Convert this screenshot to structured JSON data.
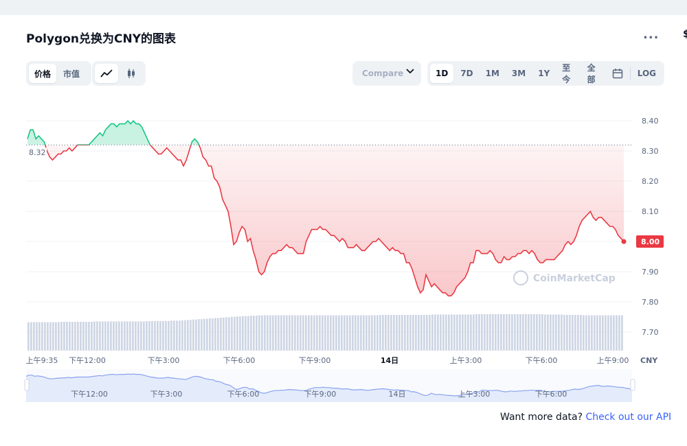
{
  "title": "Polygon兑换为CNY的图表",
  "more_label": "...",
  "edge_mark": "$",
  "toolbar": {
    "type_tabs": [
      "价格",
      "市值"
    ],
    "compare_label": "Compare",
    "ranges": [
      "1D",
      "7D",
      "1M",
      "3M",
      "1Y",
      "至今",
      "全部"
    ],
    "log_label": "LOG"
  },
  "footer": {
    "text": "Want more data? ",
    "link": "Check out our API"
  },
  "watermark": "CoinMarketCap",
  "colors": {
    "up": "#16c784",
    "down": "#ea3943",
    "volume": "#cfd6e4",
    "nav": "#e4ebfb",
    "link": "#3861fb"
  },
  "chart_data": {
    "type": "line",
    "currency_label": "CNY",
    "reference_value": 8.32,
    "reference_label": "8.32",
    "current_value": 8.0,
    "current_label": "8.00",
    "y_ticks": [
      "8.40",
      "8.30",
      "8.20",
      "8.10",
      "8.00",
      "7.90",
      "7.80",
      "7.70"
    ],
    "x_ticks": [
      "上午9:35",
      "下午12:00",
      "下午3:00",
      "下午6:00",
      "下午9:00",
      "14日",
      "上午3:00",
      "下午6:00",
      "上午9:00"
    ],
    "x_ticks_display": [
      "上午9:35",
      "下午12:00",
      "下午3:00",
      "下午6:00",
      "下午9:00",
      "14日",
      "上午3:00",
      "下午6:00",
      "上午9:00"
    ],
    "navigator_ticks": [
      "下午12:00",
      "下午3:00",
      "下午6:00",
      "下午9:00",
      "14日",
      "上午3:00",
      "下午6:00"
    ],
    "series": [
      {
        "values": [
          8.34,
          8.37,
          8.37,
          8.34,
          8.35,
          8.34,
          8.33,
          8.3,
          8.28,
          8.27,
          8.28,
          8.29,
          8.29,
          8.3,
          8.3,
          8.31,
          8.3,
          8.31,
          8.32,
          8.32,
          8.32,
          8.32,
          8.32,
          8.33,
          8.34,
          8.35,
          8.36,
          8.35,
          8.37,
          8.38,
          8.39,
          8.39,
          8.38,
          8.39,
          8.39,
          8.39,
          8.4,
          8.39,
          8.4,
          8.39,
          8.39,
          8.38,
          8.36,
          8.34,
          8.32,
          8.31,
          8.3,
          8.29,
          8.29,
          8.3,
          8.31,
          8.3,
          8.29,
          8.28,
          8.27,
          8.27,
          8.25,
          8.27,
          8.3,
          8.33,
          8.34,
          8.33,
          8.31,
          8.28,
          8.27,
          8.25,
          8.25,
          8.21,
          8.2,
          8.18,
          8.14,
          8.12,
          8.1,
          8.05,
          7.99,
          8.0,
          8.03,
          8.05,
          8.04,
          8.0,
          8.01,
          7.97,
          7.94,
          7.9,
          7.89,
          7.9,
          7.93,
          7.95,
          7.96,
          7.96,
          7.97,
          7.97,
          7.98,
          7.99,
          7.98,
          7.98,
          7.97,
          7.96,
          7.96,
          7.96,
          8.0,
          8.02,
          8.04,
          8.04,
          8.04,
          8.05,
          8.04,
          8.04,
          8.03,
          8.02,
          8.02,
          8.01,
          8.0,
          8.01,
          8.0,
          7.98,
          7.98,
          7.98,
          7.99,
          7.98,
          7.97,
          7.97,
          7.98,
          7.99,
          8.0,
          8.0,
          8.01,
          8.0,
          7.99,
          7.98,
          7.97,
          7.98,
          7.97,
          7.97,
          7.96,
          7.96,
          7.93,
          7.93,
          7.91,
          7.88,
          7.85,
          7.83,
          7.84,
          7.89,
          7.87,
          7.85,
          7.86,
          7.85,
          7.84,
          7.83,
          7.83,
          7.82,
          7.82,
          7.83,
          7.85,
          7.86,
          7.87,
          7.88,
          7.9,
          7.93,
          7.93,
          7.97,
          7.97,
          7.96,
          7.96,
          7.96,
          7.97,
          7.96,
          7.94,
          7.93,
          7.93,
          7.95,
          7.94,
          7.94,
          7.95,
          7.95,
          7.96,
          7.96,
          7.97,
          7.97,
          7.96,
          7.97,
          7.96,
          7.94,
          7.93,
          7.93,
          7.94,
          7.94,
          7.94,
          7.94,
          7.95,
          7.96,
          7.97,
          7.99,
          8.0,
          7.99,
          8.0,
          8.02,
          8.05,
          8.07,
          8.08,
          8.09,
          8.1,
          8.08,
          8.07,
          8.08,
          8.08,
          8.07,
          8.06,
          8.05,
          8.05,
          8.04,
          8.02,
          8.01,
          8.0
        ]
      }
    ],
    "volume": [
      0.74,
      0.74,
      0.74,
      0.74,
      0.74,
      0.74,
      0.74,
      0.74,
      0.74,
      0.74,
      0.74,
      0.74,
      0.75,
      0.75,
      0.75,
      0.75,
      0.75,
      0.75,
      0.75,
      0.75,
      0.75,
      0.75,
      0.75,
      0.75,
      0.76,
      0.76,
      0.76,
      0.76,
      0.76,
      0.76,
      0.76,
      0.76,
      0.76,
      0.76,
      0.76,
      0.76,
      0.76,
      0.76,
      0.76,
      0.76,
      0.76,
      0.76,
      0.76,
      0.77,
      0.77,
      0.77,
      0.77,
      0.77,
      0.77,
      0.77,
      0.77,
      0.77,
      0.78,
      0.78,
      0.78,
      0.78,
      0.79,
      0.79,
      0.8,
      0.8,
      0.81,
      0.81,
      0.82,
      0.82,
      0.83,
      0.83,
      0.84,
      0.84,
      0.85,
      0.85,
      0.86,
      0.86,
      0.87,
      0.87,
      0.88,
      0.88,
      0.89,
      0.89,
      0.9,
      0.9,
      0.9,
      0.91,
      0.91,
      0.91,
      0.92,
      0.92,
      0.92,
      0.92,
      0.92,
      0.92,
      0.92,
      0.92,
      0.92,
      0.92,
      0.92,
      0.92,
      0.92,
      0.92,
      0.92,
      0.92,
      0.92,
      0.92,
      0.92,
      0.92,
      0.92,
      0.92,
      0.92,
      0.92,
      0.92,
      0.92,
      0.92,
      0.92,
      0.92,
      0.92,
      0.92,
      0.92,
      0.92,
      0.92,
      0.92,
      0.92,
      0.92,
      0.92,
      0.92,
      0.92,
      0.92,
      0.92,
      0.92,
      0.92,
      0.93,
      0.93,
      0.93,
      0.93,
      0.93,
      0.93,
      0.93,
      0.93,
      0.93,
      0.93,
      0.93,
      0.93,
      0.93,
      0.93,
      0.93,
      0.93,
      0.93,
      0.93,
      0.93,
      0.94,
      0.94,
      0.94,
      0.94,
      0.94,
      0.94,
      0.94,
      0.94,
      0.94,
      0.94,
      0.94,
      0.94,
      0.94,
      0.94,
      0.94,
      0.94,
      0.95,
      0.95,
      0.95,
      0.95,
      0.95,
      0.95,
      0.95,
      0.95,
      0.95,
      0.95,
      0.95,
      0.95,
      0.95,
      0.95,
      0.95,
      0.95,
      0.95,
      0.95,
      0.95,
      0.95,
      0.95,
      0.95,
      0.95,
      0.95,
      0.95,
      0.94,
      0.94,
      0.94,
      0.94,
      0.94,
      0.94,
      0.94,
      0.93,
      0.93,
      0.93,
      0.93,
      0.93,
      0.93,
      0.93,
      0.92,
      0.92,
      0.92,
      0.92,
      0.92,
      0.92,
      0.92,
      0.92,
      0.92,
      0.92,
      0.92,
      0.92,
      0.92,
      0.92,
      0.92
    ]
  }
}
